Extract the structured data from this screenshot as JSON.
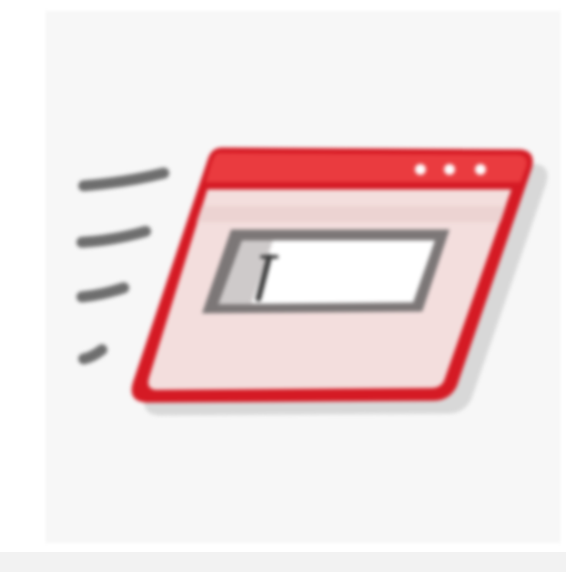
{
  "icon": {
    "name": "fast-window-launch-icon",
    "accent_color": "#d51a24",
    "frame_fill": "#f3dedd",
    "field_fill": "#ffffff",
    "speed_line_color": "#6e6e6e",
    "tile_color": "#f7f7f7"
  }
}
